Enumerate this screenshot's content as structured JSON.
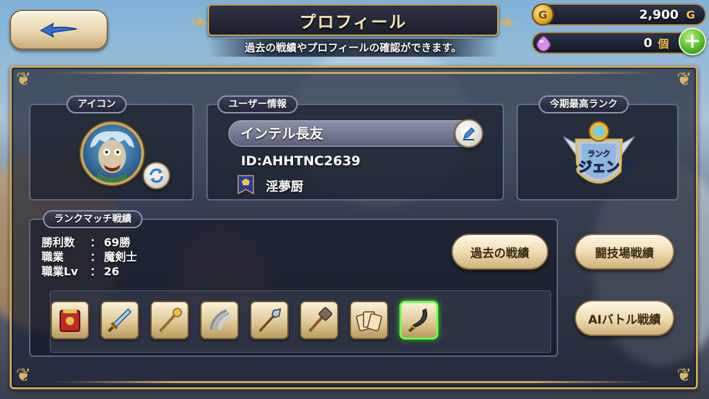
{
  "header": {
    "title": "プロフィール",
    "subtitle": "過去の戦績やプロフィールの確認ができます。"
  },
  "currency": {
    "gold_value": "2,900",
    "gold_unit": "G",
    "gem_value": "0",
    "gem_unit": "個",
    "coin_letter": "G",
    "plus_symbol": "+"
  },
  "icon_panel": {
    "label": "アイコン"
  },
  "user_panel": {
    "label": "ユーザー情報",
    "name": "インテル長友",
    "id": "ID:AHHTNC2639",
    "guild": "淫夢厨"
  },
  "rank_panel": {
    "label": "今期最高ランク",
    "rank_small": "ランク",
    "rank_name": "レジェンド"
  },
  "match_panel": {
    "label": "ランクマッチ戦績",
    "stats": [
      {
        "key": "勝利数",
        "sep": "：",
        "value": "69勝"
      },
      {
        "key": "職業",
        "sep": "：",
        "value": "魔剣士"
      },
      {
        "key": "職業Lv",
        "sep": "：",
        "value": "26"
      }
    ],
    "weapons": [
      "tome-icon",
      "sword-icon",
      "staff-icon",
      "claw-icon",
      "spear-icon",
      "hammer-icon",
      "cards-icon",
      "scimitar-icon"
    ],
    "selected_weapon": 7
  },
  "buttons": {
    "past": "過去の戦績",
    "arena": "闘技場戦績",
    "ai": "AIバトル戦績"
  },
  "colors": {
    "accent_gold": "#c9a55a",
    "selected_green": "#6bff4a",
    "gold_unit": "#f3c64a"
  }
}
